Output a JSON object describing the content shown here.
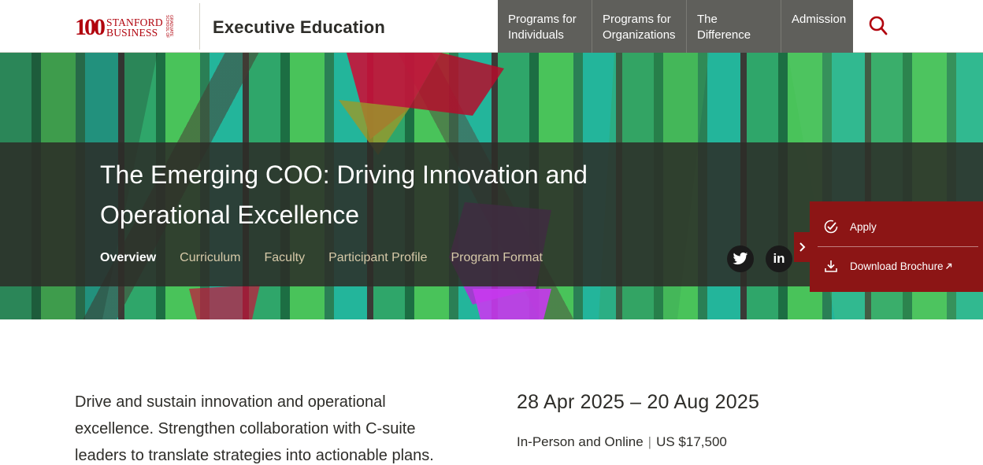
{
  "header": {
    "logo_number": "100",
    "logo_line1": "STANFORD",
    "logo_line2": "BUSINESS",
    "logo_small": "GRADUATE SCHOOL OF",
    "site_title": "Executive Education",
    "nav": [
      {
        "label": "Programs for\nIndividuals"
      },
      {
        "label": "Programs for\nOrganizations"
      },
      {
        "label": "The Difference"
      },
      {
        "label": "Admission"
      }
    ],
    "search_icon": "search-icon",
    "accent_color": "#b1040e",
    "nav_bg_color": "#5f5f5b"
  },
  "hero": {
    "title": "The Emerging COO: Driving Innovation and Operational Excellence",
    "subnav": [
      {
        "label": "Overview",
        "active": true
      },
      {
        "label": "Curriculum"
      },
      {
        "label": "Faculty"
      },
      {
        "label": "Participant Profile"
      },
      {
        "label": "Program Format"
      }
    ],
    "social": {
      "twitter_icon": "twitter-icon",
      "linkedin_label": "in"
    }
  },
  "actions": {
    "apply_label": "Apply",
    "brochure_label": "Download Brochure",
    "panel_color": "#8c1515"
  },
  "content": {
    "intro": "Drive and sustain innovation and operational excellence. Strengthen collaboration with C-suite leaders to translate strategies into actionable plans.",
    "dates": "28 Apr 2025 – 20 Aug 2025",
    "format": "In-Person and Online",
    "price": "US $17,500"
  }
}
